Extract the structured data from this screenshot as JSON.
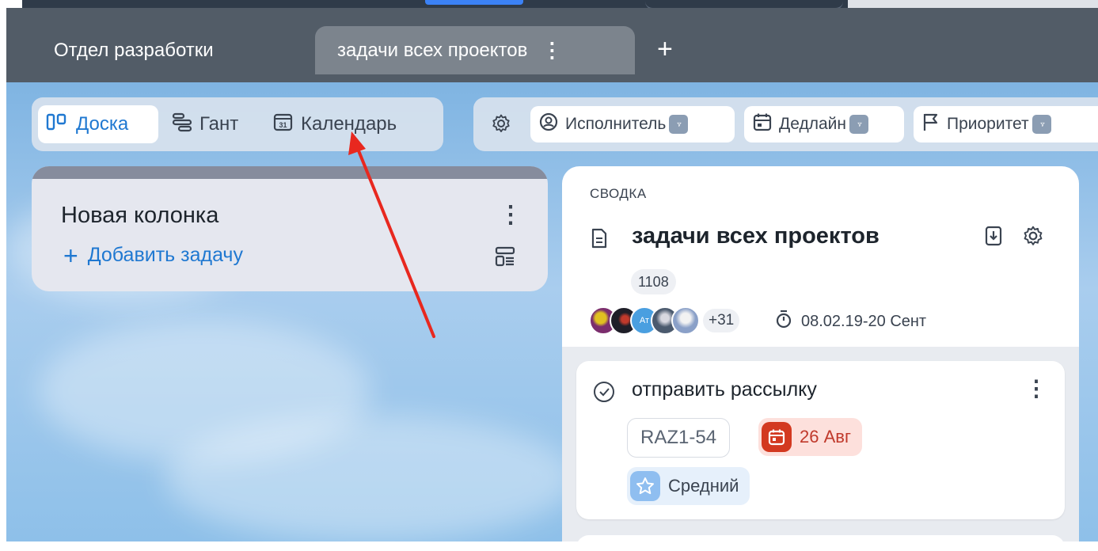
{
  "tabs": [
    {
      "label": "Отдел разработки",
      "active": false
    },
    {
      "label": "задачи всех проектов",
      "active": true
    }
  ],
  "tab_kebab": "⋮",
  "add_tab": "+",
  "views": [
    {
      "label": "Доска",
      "icon": "board-icon",
      "selected": true
    },
    {
      "label": "Гант",
      "icon": "gantt-icon",
      "selected": false
    },
    {
      "label": "Календарь",
      "icon": "calendar-icon",
      "selected": false
    }
  ],
  "filters": [
    {
      "label": "Исполнитель",
      "icon": "user-circle-icon"
    },
    {
      "label": "Дедлайн",
      "icon": "calendar-icon"
    },
    {
      "label": "Приоритет",
      "icon": "flag-icon"
    }
  ],
  "column": {
    "title": "Новая колонка",
    "kebab": "⋮",
    "add_task_plus": "+",
    "add_task_label": "Добавить задачу"
  },
  "summary": {
    "label": "СВОДКА",
    "title": "задачи всех проектов",
    "count": "1108",
    "avatars_more": "+31",
    "dates": "08.02.19-20 Сент",
    "avatar_colors": [
      "#7b2d6d",
      "#1e1e28",
      "#4a9fe0",
      "#4b5a6e",
      "#8aa0c8"
    ],
    "avatar_initials": "Ат"
  },
  "task": {
    "title": "отправить рассылку",
    "kebab": "⋮",
    "code": "RAZ1-54",
    "due": "26 Авг",
    "priority": "Средний"
  },
  "colors": {
    "accent": "#1f78d1",
    "tabbar": "#525c67",
    "due_bg": "#fde0dc",
    "due_icon": "#d33920",
    "arrow": "#e8281f"
  }
}
